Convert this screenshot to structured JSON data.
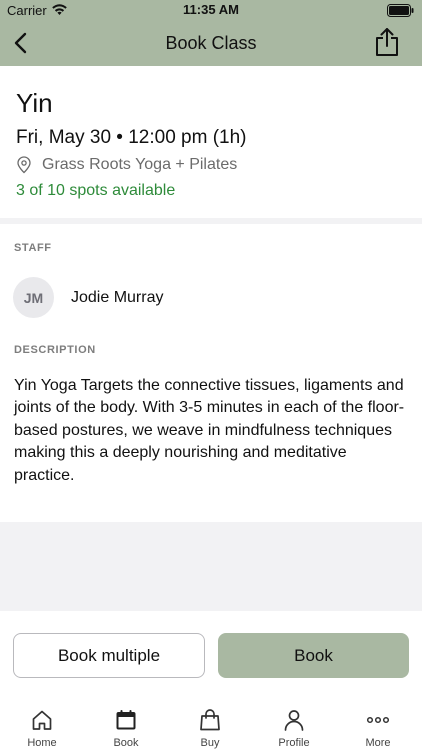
{
  "status_bar": {
    "carrier": "Carrier",
    "time": "11:35 AM"
  },
  "nav": {
    "title": "Book Class",
    "back_icon": "chevron-left-icon",
    "share_icon": "share-icon"
  },
  "class_info": {
    "title": "Yin",
    "datetime": "Fri, May 30 • 12:00 pm (1h)",
    "location": "Grass Roots Yoga + Pilates",
    "spots": "3 of 10 spots available",
    "spots_color": "#2e8b3a"
  },
  "staff": {
    "label": "STAFF",
    "initials": "JM",
    "name": "Jodie Murray"
  },
  "description": {
    "label": "DESCRIPTION",
    "text": "Yin Yoga  Targets the connective tissues, ligaments and joints of the body. With 3-5 minutes in each of the floor-based postures, we weave in mindfulness techniques making this a deeply nourishing and meditative practice."
  },
  "actions": {
    "book_multiple": "Book multiple",
    "book": "Book"
  },
  "colors": {
    "accent": "#a9b8a2"
  },
  "tabs": [
    {
      "label": "Home",
      "icon": "home-icon"
    },
    {
      "label": "Book",
      "icon": "calendar-icon"
    },
    {
      "label": "Buy",
      "icon": "shopping-bag-icon"
    },
    {
      "label": "Profile",
      "icon": "profile-icon"
    },
    {
      "label": "More",
      "icon": "more-icon"
    }
  ]
}
